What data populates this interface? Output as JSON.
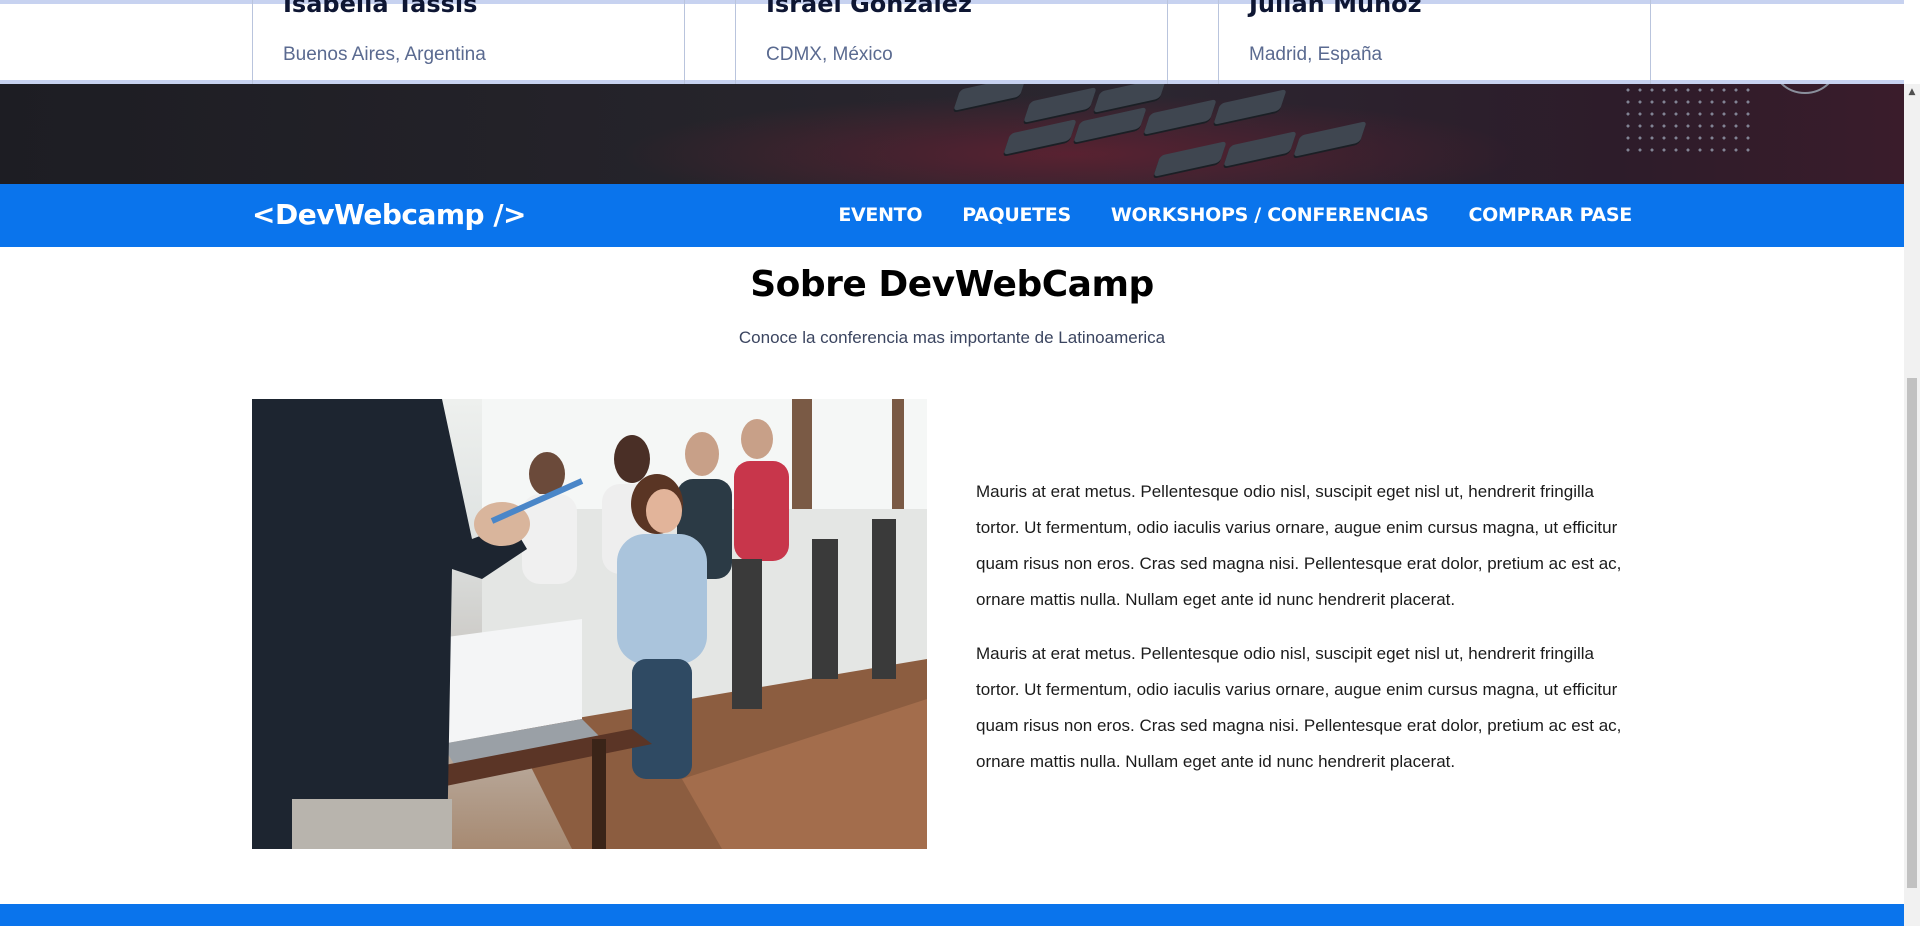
{
  "speakers": [
    {
      "name": "Isabella Tassis",
      "location": "Buenos Aires, Argentina"
    },
    {
      "name": "Israel González",
      "location": "CDMX, México"
    },
    {
      "name": "Julián Muñoz",
      "location": "Madrid, España"
    }
  ],
  "nav": {
    "logo": "<DevWebcamp />",
    "links": [
      "EVENTO",
      "PAQUETES",
      "WORKSHOPS / CONFERENCIAS",
      "COMPRAR PASE"
    ]
  },
  "about": {
    "title": "Sobre DevWebCamp",
    "subtitle": "Conoce la conferencia mas importante de Latinoamerica",
    "paragraphs": [
      "Mauris at erat metus. Pellentesque odio nisl, suscipit eget nisl ut, hendrerit fringilla tortor. Ut fermentum, odio iaculis varius ornare, augue enim cursus magna, ut efficitur quam risus non eros. Cras sed magna nisi. Pellentesque erat dolor, pretium ac est ac, ornare mattis nulla. Nullam eget ante id nunc hendrerit placerat.",
      "Mauris at erat metus. Pellentesque odio nisl, suscipit eget nisl ut, hendrerit fringilla tortor. Ut fermentum, odio iaculis varius ornare, augue enim cursus magna, ut efficitur quam risus non eros. Cras sed magna nisi. Pellentesque erat dolor, pretium ac est ac, ornare mattis nulla. Nullam eget ante id nunc hendrerit placerat."
    ]
  },
  "colors": {
    "primary_blue": "#0a74ec",
    "hero_dark": "#26242b",
    "text_muted": "#5a6a90"
  },
  "icons": {
    "scroll_up": "scroll-up-arrow-icon"
  }
}
